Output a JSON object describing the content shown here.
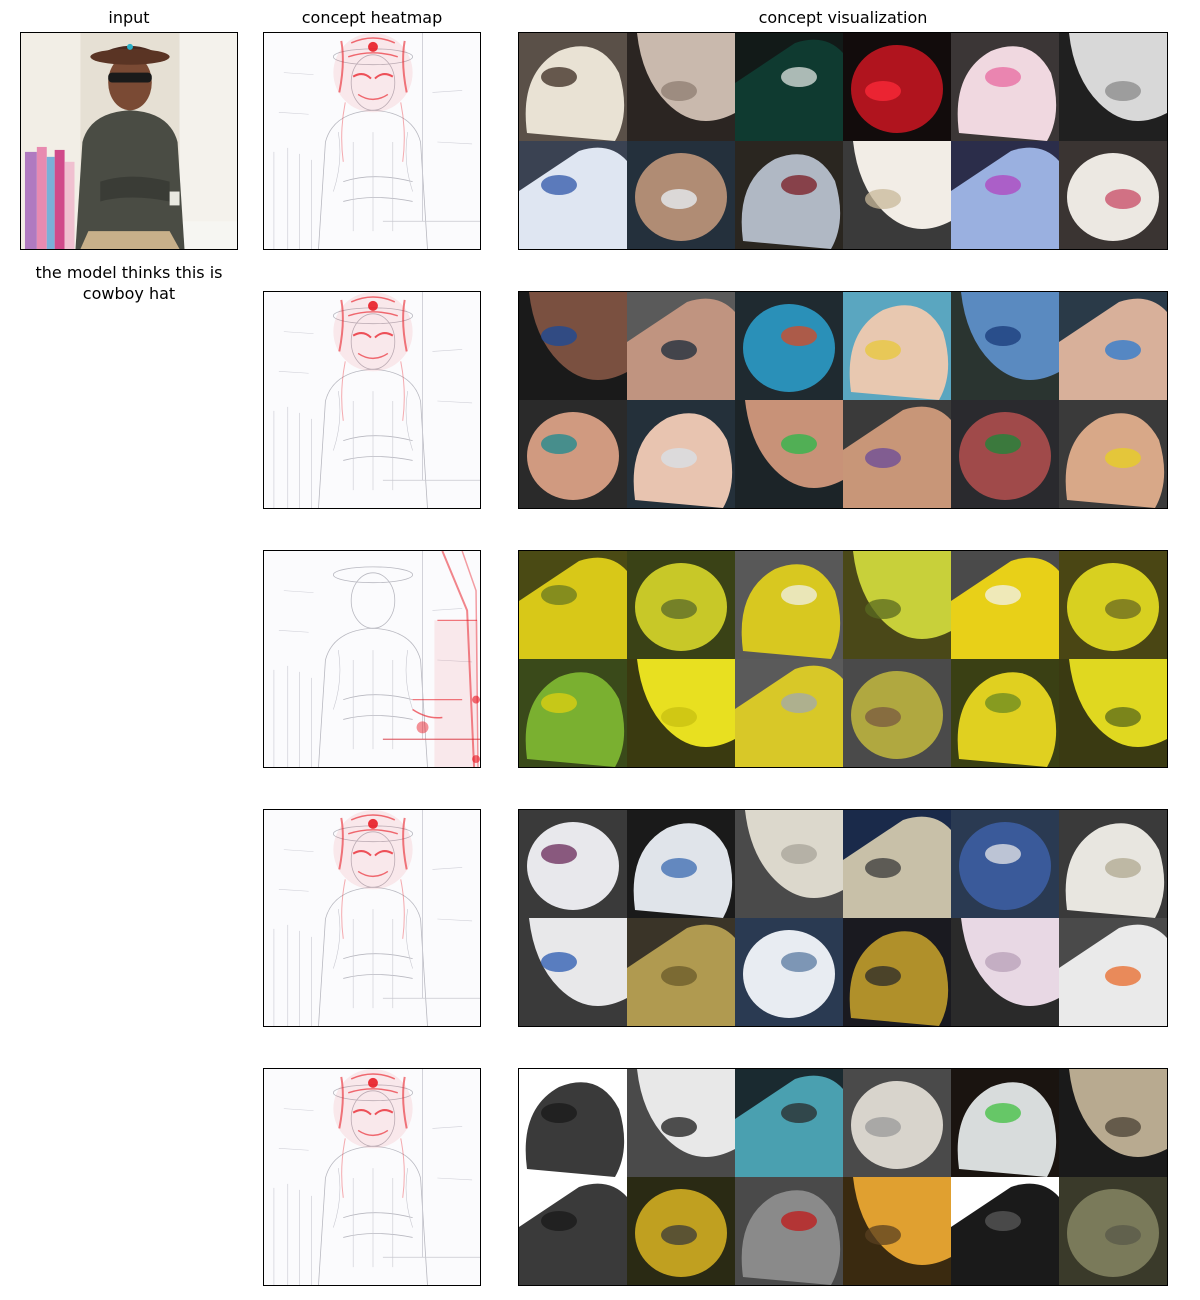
{
  "headers": {
    "input": "input",
    "heatmap": "concept heatmap",
    "visualization": "concept visualization"
  },
  "prediction": {
    "caption": "the model thinks this is\ncowboy hat"
  },
  "colors": {
    "heat": "#e8101a",
    "frame": "#000000"
  },
  "concepts": [
    {
      "heat_focus": "head",
      "tiles": [
        {
          "bg": "#5a5048",
          "fg": "#e9e2d4",
          "accent": "#3a2a20"
        },
        {
          "bg": "#2b2522",
          "fg": "#c9b9ad",
          "accent": "#8e7e72"
        },
        {
          "bg": "#121a18",
          "fg": "#0f3a30",
          "accent": "#e0e6e2"
        },
        {
          "bg": "#120c0c",
          "fg": "#b0141e",
          "accent": "#ff2a3a"
        },
        {
          "bg": "#3b3636",
          "fg": "#f0d8e0",
          "accent": "#e86aa0"
        },
        {
          "bg": "#202020",
          "fg": "#d8d8d8",
          "accent": "#8a8a8a"
        },
        {
          "bg": "#3a4252",
          "fg": "#dfe6f2",
          "accent": "#2f56a8"
        },
        {
          "bg": "#24303c",
          "fg": "#b08c74",
          "accent": "#eaf2f8"
        },
        {
          "bg": "#2a2620",
          "fg": "#b0b8c4",
          "accent": "#7a1a22"
        },
        {
          "bg": "#3a3a3a",
          "fg": "#f2ede6",
          "accent": "#c8b89a"
        },
        {
          "bg": "#2b2d4a",
          "fg": "#9ab0e0",
          "accent": "#b044c0"
        },
        {
          "bg": "#3a3432",
          "fg": "#ece8e2",
          "accent": "#c84a64"
        }
      ]
    },
    {
      "heat_focus": "head",
      "tiles": [
        {
          "bg": "#1a1a1a",
          "fg": "#7a5040",
          "accent": "#1a4a9a"
        },
        {
          "bg": "#5a5a5a",
          "fg": "#c09480",
          "accent": "#1a2a3a"
        },
        {
          "bg": "#1f2a30",
          "fg": "#2a90b8",
          "accent": "#d84a24"
        },
        {
          "bg": "#5aa6c0",
          "fg": "#e8c8b0",
          "accent": "#e8c83a"
        },
        {
          "bg": "#2a3430",
          "fg": "#5a8ac0",
          "accent": "#1a3a7a"
        },
        {
          "bg": "#2a3a48",
          "fg": "#d8b09a",
          "accent": "#2a7ad0"
        },
        {
          "bg": "#2a2a2a",
          "fg": "#d09a80",
          "accent": "#1a8a90"
        },
        {
          "bg": "#24303a",
          "fg": "#e8c4b0",
          "accent": "#d8e2ea"
        },
        {
          "bg": "#1c2428",
          "fg": "#c89278",
          "accent": "#2ab84a"
        },
        {
          "bg": "#3a3a3a",
          "fg": "#c89678",
          "accent": "#6a4a9a"
        },
        {
          "bg": "#2a2a2e",
          "fg": "#a04a4a",
          "accent": "#1a8a3a"
        },
        {
          "bg": "#3a3a3a",
          "fg": "#d8a888",
          "accent": "#e8d020"
        }
      ]
    },
    {
      "heat_focus": "right",
      "tiles": [
        {
          "bg": "#4a4a14",
          "fg": "#d8c818",
          "accent": "#6a7a20"
        },
        {
          "bg": "#3a4216",
          "fg": "#c8c828",
          "accent": "#5a6a28"
        },
        {
          "bg": "#585858",
          "fg": "#d8c820",
          "accent": "#f0f0ea"
        },
        {
          "bg": "#4a4818",
          "fg": "#c8d03a",
          "accent": "#5a6a20"
        },
        {
          "bg": "#4a4a4a",
          "fg": "#e8d018",
          "accent": "#f2f2ee"
        },
        {
          "bg": "#4a4614",
          "fg": "#d8d020",
          "accent": "#6a6a20"
        },
        {
          "bg": "#3a4a1a",
          "fg": "#7ab030",
          "accent": "#e0d010"
        },
        {
          "bg": "#3a3a10",
          "fg": "#e8e020",
          "accent": "#c8c010"
        },
        {
          "bg": "#5a5a5a",
          "fg": "#d8c828",
          "accent": "#a0a8b0"
        },
        {
          "bg": "#4a4a4a",
          "fg": "#b0a840",
          "accent": "#7a5a40"
        },
        {
          "bg": "#3a4014",
          "fg": "#e0d020",
          "accent": "#6a8a20"
        },
        {
          "bg": "#3a3a12",
          "fg": "#e0d820",
          "accent": "#5a6a1a"
        }
      ]
    },
    {
      "heat_focus": "head",
      "tiles": [
        {
          "bg": "#3a3a3a",
          "fg": "#e8e8ec",
          "accent": "#6a2a5a"
        },
        {
          "bg": "#1a1a1a",
          "fg": "#e0e4ea",
          "accent": "#3a6ab0"
        },
        {
          "bg": "#4a4a4a",
          "fg": "#dcd8cc",
          "accent": "#a8a49a"
        },
        {
          "bg": "#1a2a4a",
          "fg": "#c8c0a8",
          "accent": "#3a3a3a"
        },
        {
          "bg": "#2a3a52",
          "fg": "#3a5a9a",
          "accent": "#e8e8e8"
        },
        {
          "bg": "#3a3a3a",
          "fg": "#e8e6e0",
          "accent": "#b0a890"
        },
        {
          "bg": "#3a3a3a",
          "fg": "#e8e8ea",
          "accent": "#2a5ab0"
        },
        {
          "bg": "#3a3428",
          "fg": "#b09a50",
          "accent": "#6a5a2a"
        },
        {
          "bg": "#2a3a52",
          "fg": "#e8ecf2",
          "accent": "#5a7aa0"
        },
        {
          "bg": "#1a1a20",
          "fg": "#b0902a",
          "accent": "#2a2a2a"
        },
        {
          "bg": "#2a2a2a",
          "fg": "#e8d8e4",
          "accent": "#b8a0b8"
        },
        {
          "bg": "#4a4a4a",
          "fg": "#eaeaea",
          "accent": "#e86a2a"
        }
      ]
    },
    {
      "heat_focus": "head",
      "tiles": [
        {
          "bg": "#ffffff",
          "fg": "#3a3a3a",
          "accent": "#1a1a1a"
        },
        {
          "bg": "#4a4a4a",
          "fg": "#e8e8e8",
          "accent": "#1a1a1a"
        },
        {
          "bg": "#1a2a30",
          "fg": "#4aa0b0",
          "accent": "#2a2a2a"
        },
        {
          "bg": "#4a4a4a",
          "fg": "#d8d4cc",
          "accent": "#9a9a9a"
        },
        {
          "bg": "#1a1410",
          "fg": "#d8dcdc",
          "accent": "#40c040"
        },
        {
          "bg": "#1a1a1a",
          "fg": "#b8aa90",
          "accent": "#4a4034"
        },
        {
          "bg": "#ffffff",
          "fg": "#3a3a3a",
          "accent": "#1a1a1a"
        },
        {
          "bg": "#2a2a14",
          "fg": "#c0a020",
          "accent": "#3a3a3a"
        },
        {
          "bg": "#4a4a4a",
          "fg": "#8a8a8a",
          "accent": "#c01818"
        },
        {
          "bg": "#3a2a10",
          "fg": "#e0a030",
          "accent": "#5a4020"
        },
        {
          "bg": "#ffffff",
          "fg": "#1a1a1a",
          "accent": "#5a5a5a"
        },
        {
          "bg": "#3a3a2a",
          "fg": "#7a7a5a",
          "accent": "#5a5a4a"
        }
      ]
    }
  ]
}
